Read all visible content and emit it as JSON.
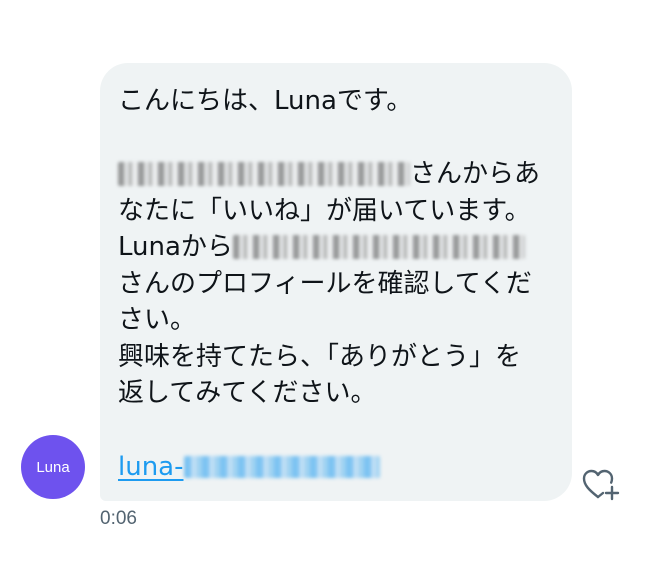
{
  "conversation": {
    "sender": {
      "avatar_label": "Luna",
      "avatar_color": "#6e52ee"
    },
    "message": {
      "greeting": "こんにちは、Lunaです。",
      "line_1_suffix": "さんからあ",
      "line_2": "なたに「いいね」が届いています。",
      "line_3_prefix": "Lunaから",
      "line_4": "さんのプロフィールを確認してくだ",
      "line_5": "さい。",
      "line_6": "興味を持てたら、「ありがとう」を",
      "line_7": "返してみてください。",
      "link_prefix": "luna-"
    },
    "timestamp": "0:06",
    "react_icon": "heart-plus-icon"
  },
  "colors": {
    "bubble_background": "#eff3f4",
    "text": "#0f1419",
    "link": "#1d9bf0",
    "muted": "#536471"
  }
}
